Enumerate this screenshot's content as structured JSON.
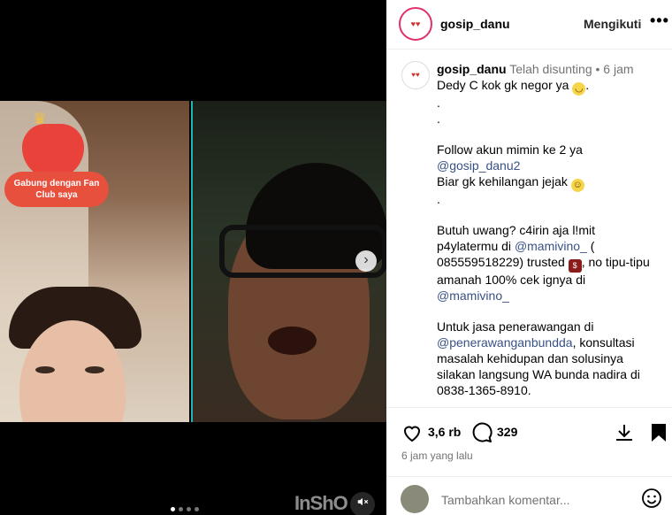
{
  "media": {
    "fanclub_label": "Gabung dengan Fan Club saya",
    "watermark": "InShO",
    "carousel_dots": 4,
    "carousel_active_index": 0
  },
  "header": {
    "username": "gosip_danu",
    "follow_label": "Mengikuti",
    "more_label": "•••"
  },
  "caption": {
    "username": "gosip_danu",
    "edited": "Telah disunting",
    "separator": "•",
    "age": "6 jam",
    "lines": [
      "Dedy C kok gk negor ya",
      ".",
      ".",
      "",
      "Follow akun mimin ke 2 ya",
      "@gosip_danu2",
      "Biar gk kehilangan jejak",
      ".",
      "",
      "Butuh uwang? c4irin aja l!mit",
      "p4ylatermu di",
      "@mamivino_",
      "(",
      "085559518229) trusted",
      ", no tipu-tipu",
      "amanah 100% cek ignya di",
      "@mamivino_",
      "",
      "Untuk jasa penerawangan di",
      "@penerawanganbundda",
      ", konsultasi",
      "masalah kehidupan dan solusinya",
      "silakan langsung WA bunda nadira di",
      "0838-1365-8910."
    ]
  },
  "actions": {
    "likes": "3,6 rb",
    "comments": "329",
    "timestamp": "6 jam yang lalu"
  },
  "comment_box": {
    "placeholder": "Tambahkan komentar..."
  },
  "icons": {
    "like": "heart-icon",
    "comment": "comment-icon",
    "share": "download-icon",
    "save": "bookmark-icon",
    "mute": "mute-icon",
    "next": "chevron-right-icon",
    "emoji": "emoji-icon"
  }
}
